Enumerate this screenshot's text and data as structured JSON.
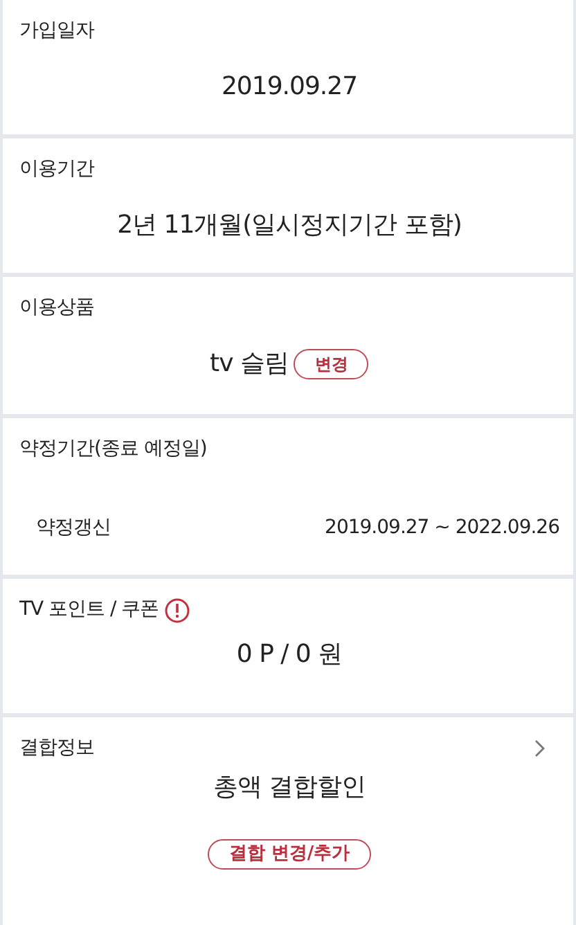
{
  "sections": [
    {
      "kind": "value",
      "title": "가입일자",
      "value": "2019.09.27"
    },
    {
      "kind": "value",
      "title": "이용기간",
      "value": "2년 11개월(일시정지기간 포함)"
    },
    {
      "kind": "product",
      "title": "이용상품",
      "value": "tv 슬림",
      "button": "변경"
    },
    {
      "kind": "term",
      "title": "약정기간(종료 예정일)",
      "row": {
        "label": "약정갱신",
        "value": "2019.09.27 ~ 2022.09.26"
      }
    },
    {
      "kind": "points",
      "title": "TV 포인트 / 쿠폰",
      "value": "0 P / 0 원"
    },
    {
      "kind": "bundle",
      "title": "결합정보",
      "value": "총액 결합할인",
      "button": "결합 변경/추가"
    }
  ]
}
